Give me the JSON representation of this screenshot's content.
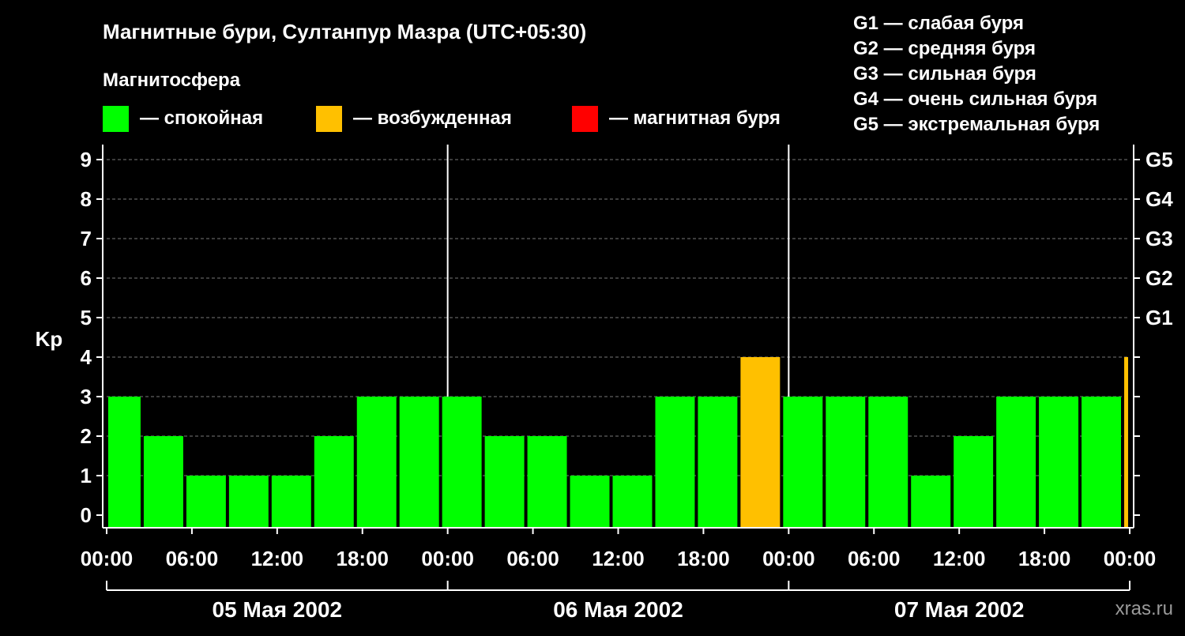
{
  "title": "Магнитные бури, Султанпур Мазра (UTC+05:30)",
  "legend": {
    "heading": "Магнитосфера",
    "items": [
      {
        "label": "— спокойная",
        "color": "#00ff00"
      },
      {
        "label": "— возбужденная",
        "color": "#ffc000"
      },
      {
        "label": "— магнитная буря",
        "color": "#ff0000"
      }
    ]
  },
  "g_scale": [
    "G1 — слабая буря",
    "G2 — средняя буря",
    "G3 — сильная буря",
    "G4 — очень сильная буря",
    "G5 — экстремальная буря"
  ],
  "watermark": "xras.ru",
  "chart_data": {
    "type": "bar",
    "ylabel": "Kp",
    "ylim": [
      0,
      9
    ],
    "y_ticks": [
      "0",
      "1",
      "2",
      "3",
      "4",
      "5",
      "6",
      "7",
      "8",
      "9"
    ],
    "g_levels": [
      {
        "label": "G1",
        "kp": 5
      },
      {
        "label": "G2",
        "kp": 6
      },
      {
        "label": "G3",
        "kp": 7
      },
      {
        "label": "G4",
        "kp": 8
      },
      {
        "label": "G5",
        "kp": 9
      }
    ],
    "x_tick_labels": [
      "00:00",
      "06:00",
      "12:00",
      "18:00",
      "00:00",
      "06:00",
      "12:00",
      "18:00",
      "00:00",
      "06:00",
      "12:00",
      "18:00",
      "00:00"
    ],
    "dates": [
      "05 Мая 2002",
      "06 Мая 2002",
      "07 Мая 2002"
    ],
    "grid": true,
    "bars": [
      {
        "start": "05 Мая 2002 00:00",
        "end": "05 Мая 2002 02:30",
        "kp": 3,
        "status": "спокойная"
      },
      {
        "start": "05 Мая 2002 02:30",
        "end": "05 Мая 2002 05:30",
        "kp": 2,
        "status": "спокойная"
      },
      {
        "start": "05 Мая 2002 05:30",
        "end": "05 Мая 2002 08:30",
        "kp": 1,
        "status": "спокойная"
      },
      {
        "start": "05 Мая 2002 08:30",
        "end": "05 Мая 2002 11:30",
        "kp": 1,
        "status": "спокойная"
      },
      {
        "start": "05 Мая 2002 11:30",
        "end": "05 Мая 2002 14:30",
        "kp": 1,
        "status": "спокойная"
      },
      {
        "start": "05 Мая 2002 14:30",
        "end": "05 Мая 2002 17:30",
        "kp": 2,
        "status": "спокойная"
      },
      {
        "start": "05 Мая 2002 17:30",
        "end": "05 Мая 2002 20:30",
        "kp": 3,
        "status": "спокойная"
      },
      {
        "start": "05 Мая 2002 20:30",
        "end": "05 Мая 2002 23:30",
        "kp": 3,
        "status": "спокойная"
      },
      {
        "start": "05 Мая 2002 23:30",
        "end": "06 Мая 2002 02:30",
        "kp": 3,
        "status": "спокойная"
      },
      {
        "start": "06 Мая 2002 02:30",
        "end": "06 Мая 2002 05:30",
        "kp": 2,
        "status": "спокойная"
      },
      {
        "start": "06 Мая 2002 05:30",
        "end": "06 Мая 2002 08:30",
        "kp": 2,
        "status": "спокойная"
      },
      {
        "start": "06 Мая 2002 08:30",
        "end": "06 Мая 2002 11:30",
        "kp": 1,
        "status": "спокойная"
      },
      {
        "start": "06 Мая 2002 11:30",
        "end": "06 Мая 2002 14:30",
        "kp": 1,
        "status": "спокойная"
      },
      {
        "start": "06 Мая 2002 14:30",
        "end": "06 Мая 2002 17:30",
        "kp": 3,
        "status": "спокойная"
      },
      {
        "start": "06 Мая 2002 17:30",
        "end": "06 Мая 2002 20:30",
        "kp": 3,
        "status": "спокойная"
      },
      {
        "start": "06 Мая 2002 20:30",
        "end": "06 Мая 2002 23:30",
        "kp": 4,
        "status": "возбужденная"
      },
      {
        "start": "06 Мая 2002 23:30",
        "end": "07 Мая 2002 02:30",
        "kp": 3,
        "status": "спокойная"
      },
      {
        "start": "07 Мая 2002 02:30",
        "end": "07 Мая 2002 05:30",
        "kp": 3,
        "status": "спокойная"
      },
      {
        "start": "07 Мая 2002 05:30",
        "end": "07 Мая 2002 08:30",
        "kp": 3,
        "status": "спокойная"
      },
      {
        "start": "07 Мая 2002 08:30",
        "end": "07 Мая 2002 11:30",
        "kp": 1,
        "status": "спокойная"
      },
      {
        "start": "07 Мая 2002 11:30",
        "end": "07 Мая 2002 14:30",
        "kp": 2,
        "status": "спокойная"
      },
      {
        "start": "07 Мая 2002 14:30",
        "end": "07 Мая 2002 17:30",
        "kp": 3,
        "status": "спокойная"
      },
      {
        "start": "07 Мая 2002 17:30",
        "end": "07 Мая 2002 20:30",
        "kp": 3,
        "status": "спокойная"
      },
      {
        "start": "07 Мая 2002 20:30",
        "end": "07 Мая 2002 23:30",
        "kp": 3,
        "status": "спокойная"
      },
      {
        "start": "07 Мая 2002 23:30",
        "end": "08 Мая 2002 00:00",
        "kp": 4,
        "status": "возбужденная"
      }
    ]
  }
}
